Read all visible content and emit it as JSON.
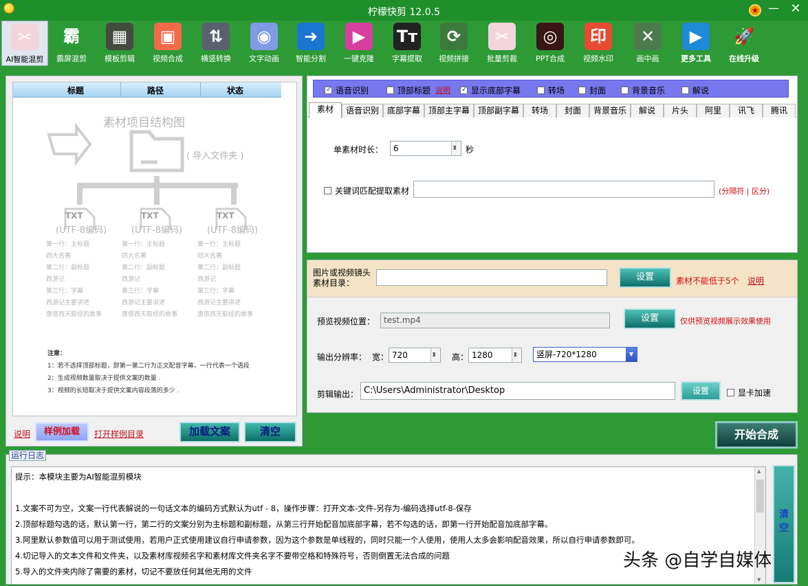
{
  "window": {
    "title": "柠檬快剪 12.0.5",
    "minimize": "—",
    "close": "✕"
  },
  "toolbar": [
    {
      "label": "AI智能混剪",
      "icon": "ai-mix-icon",
      "glyph": "✂",
      "color": "#f2d5dc"
    },
    {
      "label": "霸屏混剪",
      "icon": "bapin-icon",
      "glyph": "霸",
      "color": "#2a9a36"
    },
    {
      "label": "模板剪辑",
      "icon": "template-icon",
      "glyph": "▦",
      "color": "#444c40"
    },
    {
      "label": "视频合成",
      "icon": "video-merge-icon",
      "glyph": "▣",
      "color": "#f36a4b"
    },
    {
      "label": "横竖转换",
      "icon": "orientation-icon",
      "glyph": "⇅",
      "color": "#5a6070"
    },
    {
      "label": "文字动画",
      "icon": "text-anim-icon",
      "glyph": "◉",
      "color": "#7e9be4"
    },
    {
      "label": "智能分割",
      "icon": "split-icon",
      "glyph": "➜",
      "color": "#1b76d2"
    },
    {
      "label": "一键克隆",
      "icon": "clone-icon",
      "glyph": "▶",
      "color": "#d63fa0"
    },
    {
      "label": "字幕提取",
      "icon": "subtitle-icon",
      "glyph": "Tт",
      "color": "#222222"
    },
    {
      "label": "视频拼接",
      "icon": "concat-icon",
      "glyph": "⟳",
      "color": "#3b7a3b"
    },
    {
      "label": "批量剪裁",
      "icon": "batch-crop-icon",
      "glyph": "✂",
      "color": "#f2d5dc"
    },
    {
      "label": "PPT合成",
      "icon": "ppt-icon",
      "glyph": "◎",
      "color": "#3a1515"
    },
    {
      "label": "视频水印",
      "icon": "watermark-icon",
      "glyph": "印",
      "color": "#e84a34"
    },
    {
      "label": "画中画",
      "icon": "pip-icon",
      "glyph": "✕",
      "color": "#4f7a4f"
    },
    {
      "label": "更多工具",
      "icon": "more-tools-icon",
      "glyph": "▶",
      "color": "#1f8ad8"
    },
    {
      "label": "在线升级",
      "icon": "upgrade-icon",
      "glyph": "🚀",
      "color": "#2e9a36"
    }
  ],
  "left": {
    "columns": [
      "标题",
      "路径",
      "状态"
    ],
    "diagram_title": "素材项目结构图",
    "import_label": "( 导入文件夹 )",
    "file_label": "TXT",
    "encoding": "(UTF-8编码)",
    "sample_lines": [
      "第一行：主标题",
      "四大名著",
      "第二行：副标题",
      "西游记",
      "第三行：字幕",
      "西游记主要讲述",
      "唐僧西天取经的故事"
    ],
    "notes_heading": "注意：",
    "notes": [
      "1：若不选择顶部标题，即第一第二行为正文配音字幕，一行代表一个语段",
      "2：生成视频数量取决于提供文案的数量 .",
      "3：视频的长短取决于提供文案内容段落的多少 ."
    ],
    "link_help": "说明",
    "btn_sample": "样例加载",
    "link_open_sample": "打开样例目录",
    "btn_load": "加载文案",
    "btn_clear": "清空"
  },
  "checkbar": [
    {
      "label": "语音识别",
      "checked": true
    },
    {
      "label": "顶部标题",
      "checked": false
    },
    {
      "label": "显示底部字幕",
      "checked": true
    },
    {
      "label": "转场",
      "checked": false
    },
    {
      "label": "封面",
      "checked": false
    },
    {
      "label": "背景音乐",
      "checked": false
    },
    {
      "label": "解说",
      "checked": false
    }
  ],
  "checkbar_help": "说明",
  "tabs": [
    "素材",
    "语音识别",
    "底部字幕",
    "顶部主字幕",
    "顶部副字幕",
    "转场",
    "封面",
    "背景音乐",
    "解说",
    "片头",
    "阿里",
    "讯飞",
    "腾讯"
  ],
  "material": {
    "duration_label": "单素材时长：",
    "duration_value": "6",
    "duration_unit": "秒",
    "keyword_label": "关键词匹配提取素材",
    "keyword_value": "",
    "keyword_hint": "(分隔符 | 区分)"
  },
  "settings": {
    "dir_label_1": "图片或视频镜头",
    "dir_label_2": "素材目录：",
    "dir_value": "",
    "set_label": "设置",
    "dir_warning": "素材不能低于5个",
    "dir_help": "说明",
    "preview_label": "预览视频位置：",
    "preview_value": "test.mp4",
    "preview_hint": "仅供预览视频展示效果使用",
    "res_label": "输出分辨率：",
    "width_label": "宽：",
    "width_value": "720",
    "height_label": "高：",
    "height_value": "1280",
    "preset_value": "竖屏-720*1280",
    "output_label": "剪辑输出：",
    "output_value": "C:\\Users\\Administrator\\Desktop",
    "gpu_label": "显卡加速"
  },
  "start_button": "开始合成",
  "log": {
    "legend": "运行日志",
    "lines": [
      "提示：本模块主要为AI智能混剪模块",
      "",
      "1.文案不可为空，文案一行代表解说的一句话文本的编码方式默认为utf - 8，操作步骤：打开文本-文件-另存为-编码选择utf-8-保存",
      "2.顶部标题勾选的话，默认第一行，第二行的文案分别为主标题和副标题，从第三行开始配音加底部字幕，若不勾选的话，即第一行开始配音加底部字幕。",
      "3.阿里默认参数值可以用于测试使用，若用户正式使用建议自行申请参数，因为这个参数是单线程的，同时只能一个人使用，使用人太多会影响配音效果，所以自行申请参数即可。",
      "4.切记导入的文本文件和文件夹，以及素材库视频名字和素材库文件夹名字不要带空格和特殊符号，否则倒置无法合成的问题",
      "5.导入的文件夹内除了需要的素材，切记不要放任何其他无用的文件"
    ],
    "clear_button": "清空"
  },
  "watermark": "头条 @自学自媒体"
}
